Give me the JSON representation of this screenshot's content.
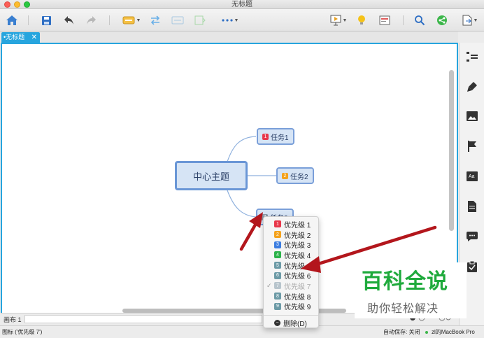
{
  "window": {
    "title": "无标题"
  },
  "tab": {
    "label": "•无标题",
    "close_glyph": "✕"
  },
  "toolbar": {
    "icons": [
      "home-icon",
      "save-icon",
      "undo-icon",
      "redo-icon",
      "insert-topic-icon",
      "relationship-icon",
      "summary-icon",
      "boundary-icon",
      "more-icon",
      "presentation-icon",
      "idea-icon",
      "outline-icon",
      "search-icon",
      "share-icon",
      "export-icon"
    ]
  },
  "mindmap": {
    "central": "中心主题",
    "topics": [
      {
        "label": "任务1",
        "priority": "1",
        "color": "#e8374a"
      },
      {
        "label": "任务2",
        "priority": "2",
        "color": "#f4a21c"
      },
      {
        "label": "任务3",
        "priority": "7",
        "color": "#8a9aa8"
      }
    ]
  },
  "context_menu": {
    "items": [
      {
        "badge": "1",
        "label": "优先级 1",
        "color": "#e8374a",
        "checked": false,
        "disabled": false
      },
      {
        "badge": "2",
        "label": "优先级 2",
        "color": "#f4a21c",
        "checked": false,
        "disabled": false
      },
      {
        "badge": "3",
        "label": "优先级 3",
        "color": "#3b7de0",
        "checked": false,
        "disabled": false
      },
      {
        "badge": "4",
        "label": "优先级 4",
        "color": "#2cb24a",
        "checked": false,
        "disabled": false
      },
      {
        "badge": "5",
        "label": "优先级 5",
        "color": "#6c9aa6",
        "checked": false,
        "disabled": false
      },
      {
        "badge": "6",
        "label": "优先级 6",
        "color": "#6c9aa6",
        "checked": false,
        "disabled": false
      },
      {
        "badge": "7",
        "label": "优先级 7",
        "color": "#b7c4cc",
        "checked": true,
        "disabled": true
      },
      {
        "badge": "8",
        "label": "优先级 8",
        "color": "#6c9aa6",
        "checked": false,
        "disabled": false
      },
      {
        "badge": "9",
        "label": "优先级 9",
        "color": "#6c9aa6",
        "checked": false,
        "disabled": false
      }
    ],
    "check_glyph": "✓",
    "delete_label": "删除(D)"
  },
  "sheet": {
    "tab_label": "画布 1"
  },
  "status": {
    "left": "图标 ('优先级 7')",
    "autosave": "自动保存: 关闭",
    "user": "zl的MacBook Pro"
  },
  "watermark": {
    "title": "百科全说",
    "subtitle": "助你轻松解决"
  },
  "colors": {
    "accent": "#27a5de",
    "topic_border": "#7a9fd9",
    "topic_fill": "#d6e4f5",
    "arrow": "#b3161c"
  }
}
